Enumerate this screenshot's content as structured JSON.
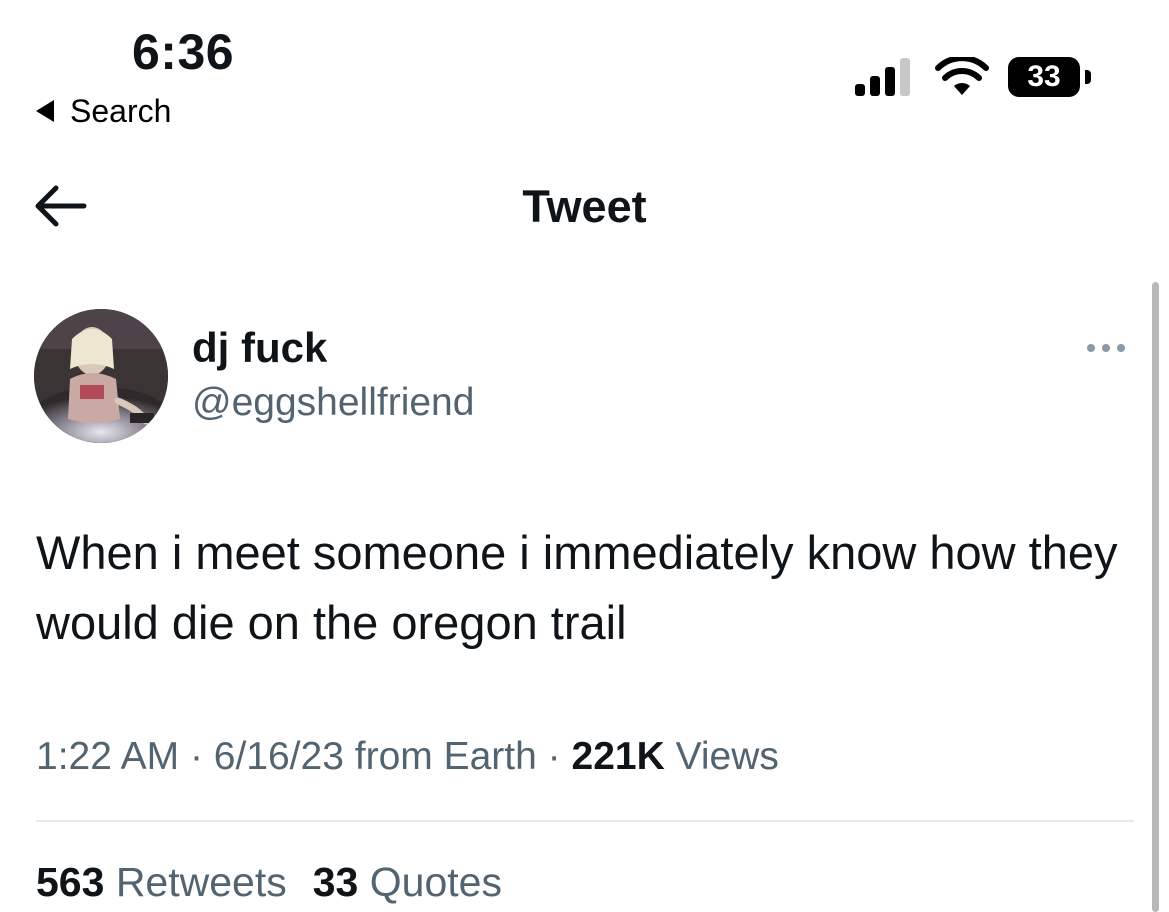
{
  "status_bar": {
    "time": "6:36",
    "back_app_label": "Search",
    "battery_level": "33"
  },
  "header": {
    "title": "Tweet",
    "back_icon": "arrow-left-icon"
  },
  "tweet": {
    "author": {
      "display_name": "dj fuck",
      "handle": "@eggshellfriend"
    },
    "more_icon": "more-horizontal-icon",
    "text": "When i meet someone i immediately know how they would die on the oregon trail",
    "time": "1:22 AM",
    "separator": "·",
    "date": "6/16/23",
    "source": "from Earth",
    "views_count": "221K",
    "views_label": "Views",
    "stats": {
      "retweets_count": "563",
      "retweets_label": "Retweets",
      "quotes_count": "33",
      "quotes_label": "Quotes"
    }
  },
  "colors": {
    "text_primary": "#0f1419",
    "text_secondary": "#536471",
    "divider": "#e6e9eb",
    "background": "#ffffff"
  }
}
